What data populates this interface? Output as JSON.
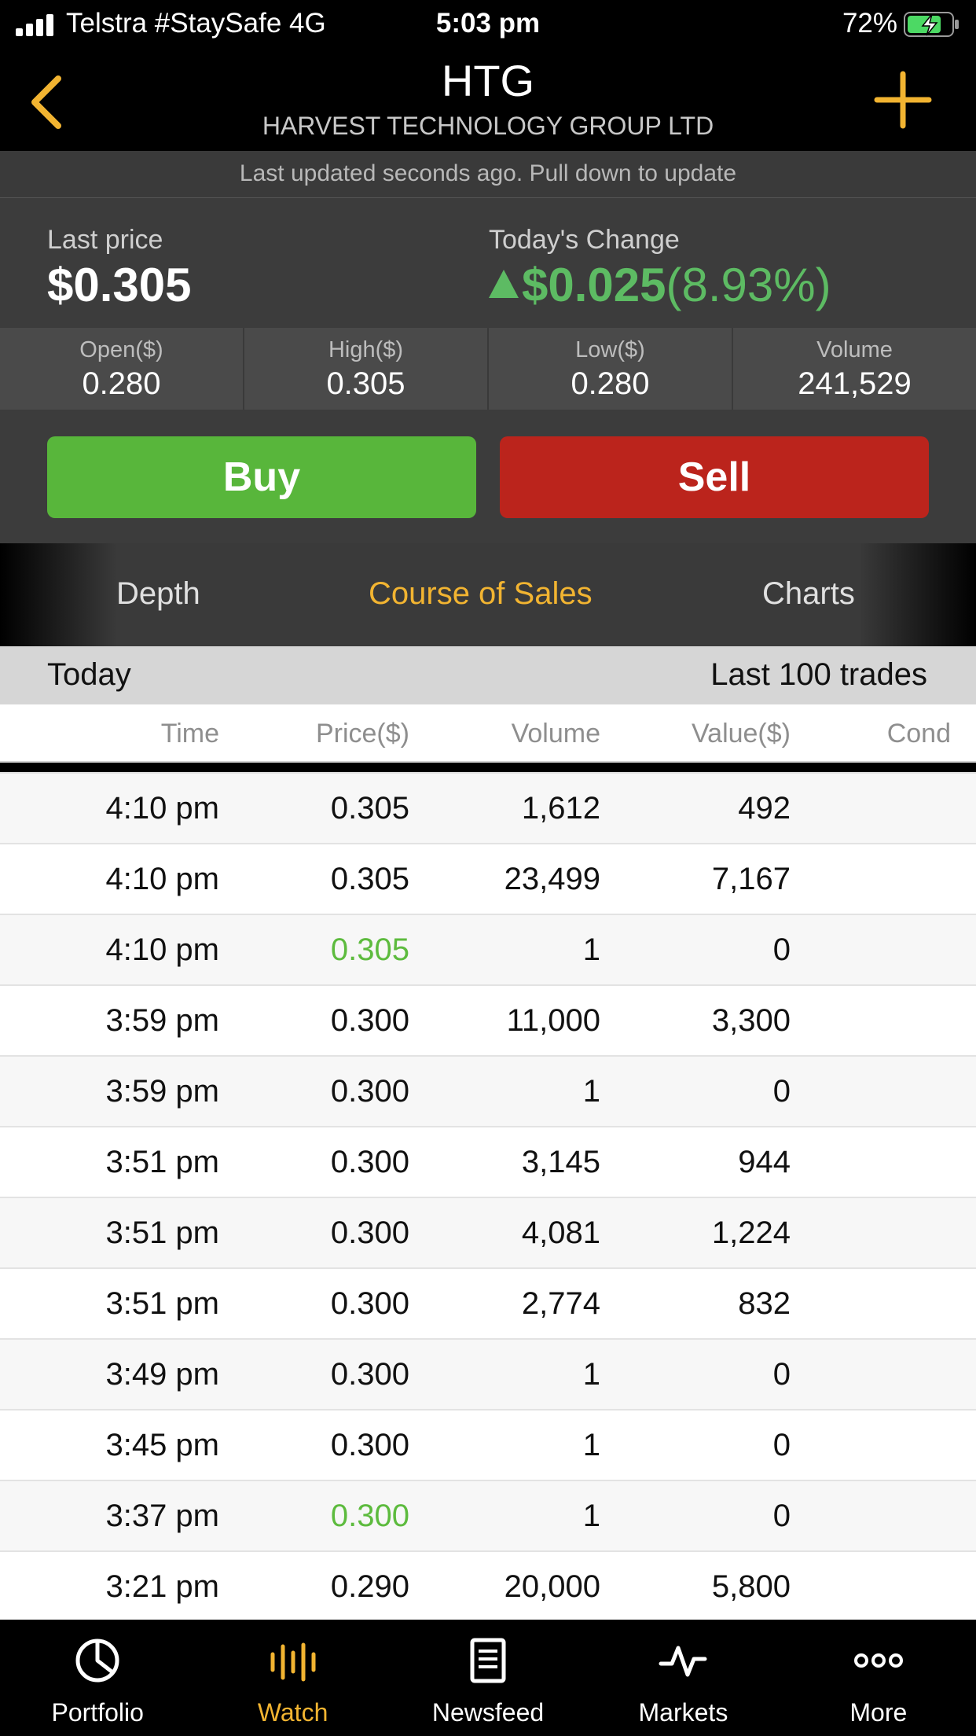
{
  "status": {
    "carrier": "Telstra #StaySafe  4G",
    "time": "5:03 pm",
    "battery": "72%"
  },
  "nav": {
    "ticker": "HTG",
    "company": "HARVEST TECHNOLOGY GROUP LTD"
  },
  "banner": "Last updated seconds ago. Pull down to update",
  "quote": {
    "last_price_label": "Last price",
    "last_price": "$0.305",
    "change_label": "Today's Change",
    "change_value": "$0.025",
    "change_pct": "(8.93%)",
    "accent_up": "#5dbb63"
  },
  "stats": [
    {
      "label": "Open($)",
      "value": "0.280"
    },
    {
      "label": "High($)",
      "value": "0.305"
    },
    {
      "label": "Low($)",
      "value": "0.280"
    },
    {
      "label": "Volume",
      "value": "241,529"
    }
  ],
  "actions": {
    "buy": "Buy",
    "sell": "Sell"
  },
  "tabs": {
    "depth": "Depth",
    "course": "Course of Sales",
    "charts": "Charts",
    "active": "Course of Sales"
  },
  "section": {
    "left": "Today",
    "right": "Last 100 trades"
  },
  "columns": {
    "time": "Time",
    "price": "Price($)",
    "volume": "Volume",
    "value": "Value($)",
    "cond": "Cond"
  },
  "trades": [
    {
      "time": "4:10 pm",
      "price": "0.305",
      "volume": "1,612",
      "value": "492",
      "cond": "",
      "price_up": false
    },
    {
      "time": "4:10 pm",
      "price": "0.305",
      "volume": "23,499",
      "value": "7,167",
      "cond": "",
      "price_up": false
    },
    {
      "time": "4:10 pm",
      "price": "0.305",
      "volume": "1",
      "value": "0",
      "cond": "",
      "price_up": true
    },
    {
      "time": "3:59 pm",
      "price": "0.300",
      "volume": "11,000",
      "value": "3,300",
      "cond": "",
      "price_up": false
    },
    {
      "time": "3:59 pm",
      "price": "0.300",
      "volume": "1",
      "value": "0",
      "cond": "",
      "price_up": false
    },
    {
      "time": "3:51 pm",
      "price": "0.300",
      "volume": "3,145",
      "value": "944",
      "cond": "",
      "price_up": false
    },
    {
      "time": "3:51 pm",
      "price": "0.300",
      "volume": "4,081",
      "value": "1,224",
      "cond": "",
      "price_up": false
    },
    {
      "time": "3:51 pm",
      "price": "0.300",
      "volume": "2,774",
      "value": "832",
      "cond": "",
      "price_up": false
    },
    {
      "time": "3:49 pm",
      "price": "0.300",
      "volume": "1",
      "value": "0",
      "cond": "",
      "price_up": false
    },
    {
      "time": "3:45 pm",
      "price": "0.300",
      "volume": "1",
      "value": "0",
      "cond": "",
      "price_up": false
    },
    {
      "time": "3:37 pm",
      "price": "0.300",
      "volume": "1",
      "value": "0",
      "cond": "",
      "price_up": true
    },
    {
      "time": "3:21 pm",
      "price": "0.290",
      "volume": "20,000",
      "value": "5,800",
      "cond": "",
      "price_up": false
    }
  ],
  "tabbar": [
    {
      "label": "Portfolio",
      "icon": "pie-chart-icon"
    },
    {
      "label": "Watch",
      "icon": "watch-bars-icon",
      "active": true
    },
    {
      "label": "Newsfeed",
      "icon": "newspaper-icon"
    },
    {
      "label": "Markets",
      "icon": "pulse-line-icon"
    },
    {
      "label": "More",
      "icon": "more-dots-icon"
    }
  ],
  "colors": {
    "accent": "#f2b431",
    "buy": "#58b63b",
    "sell": "#bb241c",
    "up": "#5dbb3e"
  }
}
